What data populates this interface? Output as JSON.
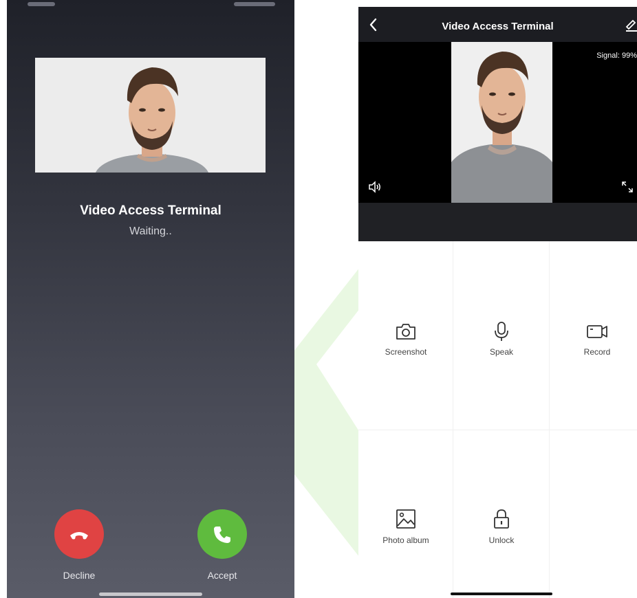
{
  "incoming_call": {
    "caller_name": "Video Access Terminal",
    "status": "Waiting..",
    "decline_label": "Decline",
    "accept_label": "Accept",
    "colors": {
      "decline": "#e04343",
      "accept": "#5fbb3e"
    }
  },
  "app": {
    "title": "Video Access Terminal",
    "signal": "Signal: 99%",
    "actions": [
      {
        "label": "Screenshot",
        "icon": "camera-icon"
      },
      {
        "label": "Speak",
        "icon": "microphone-icon"
      },
      {
        "label": "Record",
        "icon": "video-camera-icon"
      },
      {
        "label": "Photo album",
        "icon": "image-icon"
      },
      {
        "label": "Unlock",
        "icon": "lock-icon"
      }
    ]
  }
}
